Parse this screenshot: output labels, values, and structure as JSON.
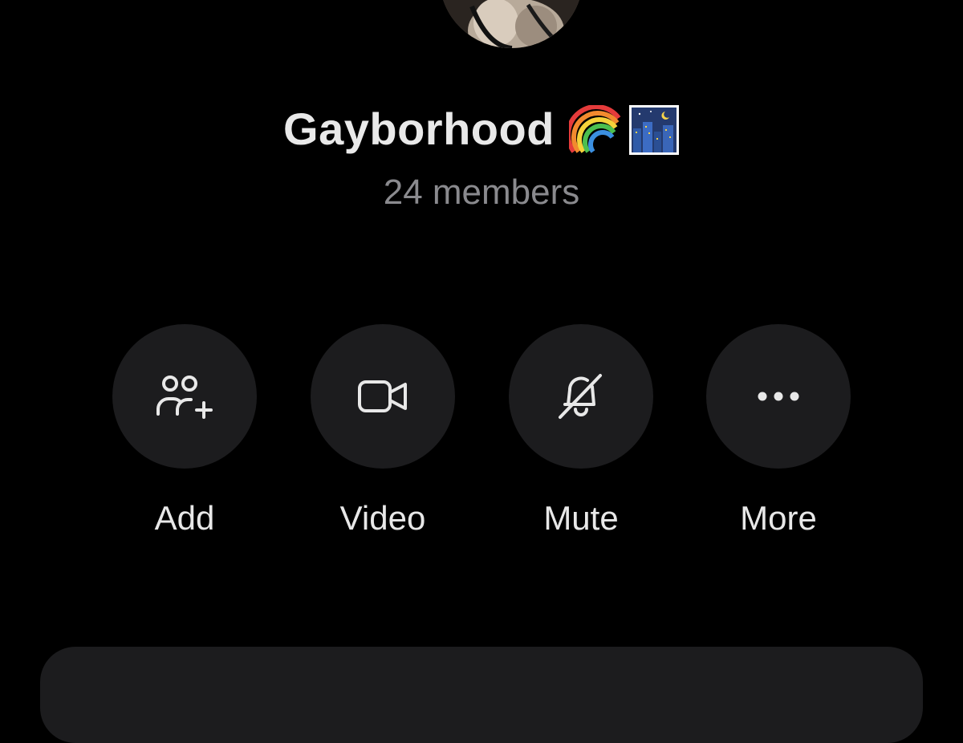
{
  "group": {
    "name": "Gayborhood",
    "emojis": [
      "rainbow-emoji",
      "night-city-emoji"
    ],
    "member_count": "24 members"
  },
  "actions": [
    {
      "label": "Add",
      "icon": "add-people-icon"
    },
    {
      "label": "Video",
      "icon": "video-camera-icon"
    },
    {
      "label": "Mute",
      "icon": "bell-slash-icon"
    },
    {
      "label": "More",
      "icon": "ellipsis-icon"
    }
  ],
  "colors": {
    "background": "#000000",
    "button_bg": "#1c1c1e",
    "primary_text": "#e8e8e8",
    "secondary_text": "#8a8a8e"
  }
}
